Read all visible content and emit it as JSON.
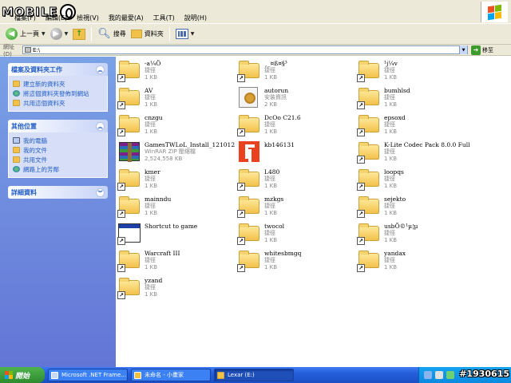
{
  "menu": {
    "items": [
      "檔案(F)",
      "編輯(E)",
      "檢視(V)",
      "我的最愛(A)",
      "工具(T)",
      "說明(H)"
    ]
  },
  "toolbar": {
    "back_label": "上一頁",
    "search_label": "搜尋",
    "folders_label": "資料夾"
  },
  "address": {
    "label": "網址(D)",
    "path": "E:\\",
    "go_label": "移至"
  },
  "sidebar": {
    "panels": [
      {
        "title": "檔案及資料夾工作",
        "items": [
          "建立新的資料夾",
          "將這個資料夾發佈到網站",
          "共用這個資料夾"
        ]
      },
      {
        "title": "其他位置",
        "items": [
          "我的電腦",
          "我的文件",
          "共用文件",
          "網路上的芳鄰"
        ]
      },
      {
        "title": "詳細資料",
        "items": []
      }
    ]
  },
  "files": [
    {
      "name": "-a¼Ö",
      "type": "捷徑",
      "size": "1 KB",
      "icon": "folder-shortcut"
    },
    {
      "name": "¸_¤ß¤§³",
      "type": "捷徑",
      "size": "1 KB",
      "icon": "folder-shortcut"
    },
    {
      "name": "¹j¼v",
      "type": "捷徑",
      "size": "1 KB",
      "icon": "folder-shortcut"
    },
    {
      "name": "AV",
      "type": "捷徑",
      "size": "1 KB",
      "icon": "folder-shortcut"
    },
    {
      "name": "autorun",
      "type": "安裝資訊",
      "size": "2 KB",
      "icon": "setup-info"
    },
    {
      "name": "bumhlsd",
      "type": "捷徑",
      "size": "1 KB",
      "icon": "folder-shortcut"
    },
    {
      "name": "cnzgu",
      "type": "捷徑",
      "size": "1 KB",
      "icon": "folder-shortcut"
    },
    {
      "name": "DcOo C21.6",
      "type": "捷徑",
      "size": "1 KB",
      "icon": "folder-shortcut"
    },
    {
      "name": "epsoxd",
      "type": "捷徑",
      "size": "1 KB",
      "icon": "folder-shortcut"
    },
    {
      "name": "GamesTWLoL_Install_121012",
      "type": "WinRAR ZIP 壓縮檔",
      "size": "2,524,558 KB",
      "icon": "winrar-archive"
    },
    {
      "name": "kb146131",
      "type": "",
      "size": "",
      "icon": "flash-file"
    },
    {
      "name": "K-Lite Codec Pack 8.0.0 Full",
      "type": "捷徑",
      "size": "1 KB",
      "icon": "folder-shortcut"
    },
    {
      "name": "kmer",
      "type": "捷徑",
      "size": "1 KB",
      "icon": "folder-shortcut"
    },
    {
      "name": "L480",
      "type": "捷徑",
      "size": "1 KB",
      "icon": "folder-shortcut"
    },
    {
      "name": "loopqs",
      "type": "捷徑",
      "size": "1 KB",
      "icon": "folder-shortcut"
    },
    {
      "name": "mainndu",
      "type": "捷徑",
      "size": "1 KB",
      "icon": "folder-shortcut"
    },
    {
      "name": "mzkgs",
      "type": "捷徑",
      "size": "1 KB",
      "icon": "folder-shortcut"
    },
    {
      "name": "sejekto",
      "type": "捷徑",
      "size": "1 KB",
      "icon": "folder-shortcut"
    },
    {
      "name": "Shortcut to game",
      "type": "",
      "size": "",
      "icon": "window-shortcut"
    },
    {
      "name": "twocol",
      "type": "捷徑",
      "size": "1 KB",
      "icon": "folder-shortcut"
    },
    {
      "name": "usbÕ©¹µ¦µ",
      "type": "捷徑",
      "size": "1 KB",
      "icon": "folder-shortcut"
    },
    {
      "name": "Warcraft III",
      "type": "捷徑",
      "size": "1 KB",
      "icon": "folder-shortcut"
    },
    {
      "name": "whitesbmgq",
      "type": "捷徑",
      "size": "1 KB",
      "icon": "folder-shortcut"
    },
    {
      "name": "yandax",
      "type": "捷徑",
      "size": "1 KB",
      "icon": "folder-shortcut"
    },
    {
      "name": "yzand",
      "type": "捷徑",
      "size": "1 KB",
      "icon": "folder-shortcut"
    }
  ],
  "taskbar": {
    "start_label": "開始",
    "buttons": [
      {
        "label": "Microsoft .NET Frame...",
        "active": false
      },
      {
        "label": "未命名 - 小畫家",
        "active": false
      },
      {
        "label": "Lexar (E:)",
        "active": true
      }
    ]
  },
  "logo_text": "MOBILE01",
  "watermark": "#1930615",
  "colors": {
    "sidebar_top": "#7aa1e6",
    "sidebar_bottom": "#6375d6",
    "taskbar": "#245edb",
    "start_green": "#2e8a2e"
  }
}
